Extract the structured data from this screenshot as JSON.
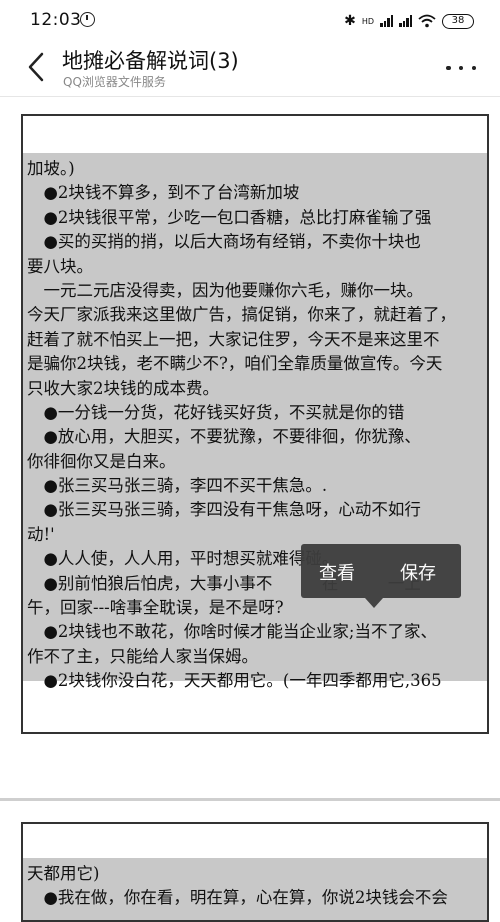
{
  "status_bar": {
    "time": "12:03",
    "network_label": "HD",
    "battery_level": "38"
  },
  "app_bar": {
    "title": "地摊必备解说词(3)",
    "subtitle": "QQ浏览器文件服务"
  },
  "document": {
    "page1_lines": [
      "加坡。)",
      "　●2块钱不算多，到不了台湾新加坡",
      "　●2块钱很平常，少吃一包口香糖，总比打麻雀输了强",
      "　●买的买捎的捎，以后大商场有经销，不卖你十块也",
      "要八块。",
      "　一元二元店没得卖，因为他要赚你六毛，赚你一块。",
      "今天厂家派我来这里做广告，搞促销，你来了，就赶着了，",
      "赶着了就不怕买上一把，大家记住罗，今天不是来这里不",
      "是骗你2块钱，老不瞒少不?，咱们全靠质量做宣传。今天",
      "只收大家2块钱的成本费。",
      "　●一分钱一分货，花好钱买好货，不买就是你的错",
      "　●放心用，大胆买，不要犹豫，不要徘徊，你犹豫、",
      "你徘徊你又是白来。",
      "　●张三买马张三骑，李四不买干焦急。.",
      "　●张三买马张三骑，李四没有干焦急呀，心动不如行",
      "动!'",
      "　●人人使，人人用，平时想买就难得碰。",
      "　●别前怕狼后怕虎，大事小事不　　　在　　　一上",
      "午，回家---啥事全耽误，是不是呀?",
      "　●2块钱也不敢花，你啥时候才能当企业家;当不了家、",
      "作不了主，只能给人家当保姆。",
      "　●2块钱你没白花，天天都用它。(一年四季都用它,365"
    ],
    "page2_lines": [
      "天都用它)",
      "　●我在做，你在看，明在算，心在算，你说2块钱会不会"
    ]
  },
  "context_menu": {
    "view_label": "查看",
    "save_label": "保存"
  }
}
